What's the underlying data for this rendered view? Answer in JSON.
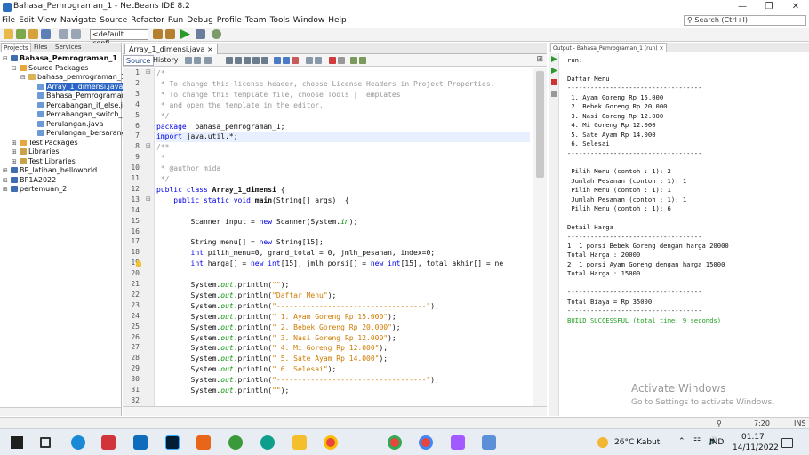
{
  "window": {
    "title": "Bahasa_Pemrograman_1 - NetBeans IDE 8.2"
  },
  "menu": [
    "File",
    "Edit",
    "View",
    "Navigate",
    "Source",
    "Refactor",
    "Run",
    "Debug",
    "Profile",
    "Team",
    "Tools",
    "Window",
    "Help"
  ],
  "search": {
    "placeholder": "Search (Ctrl+I)"
  },
  "toolbar": {
    "config": "<default confi..."
  },
  "projects": {
    "tabs": [
      "Projects",
      "Files",
      "Services"
    ],
    "tree": [
      {
        "label": "Bahasa_Pemrograman_1",
        "level": 0,
        "bold": true,
        "toggle": "−",
        "icon": "#3d6fb0"
      },
      {
        "label": "Source Packages",
        "level": 1,
        "toggle": "−",
        "icon": "#e7a73a"
      },
      {
        "label": "bahasa_pemrograman_1",
        "level": 2,
        "toggle": "−",
        "icon": "#d9b25a"
      },
      {
        "label": "Array_1_dimensi.java",
        "level": 3,
        "selected": true,
        "icon": "#6b9ad6"
      },
      {
        "label": "Bahasa_Pemrograman_1.java",
        "level": 3,
        "icon": "#6b9ad6"
      },
      {
        "label": "Percabangan_if_else.java",
        "level": 3,
        "icon": "#6b9ad6"
      },
      {
        "label": "Percabangan_switch_case.java",
        "level": 3,
        "icon": "#6b9ad6"
      },
      {
        "label": "Perulangan.java",
        "level": 3,
        "icon": "#6b9ad6"
      },
      {
        "label": "Perulangan_bersarang.java",
        "level": 3,
        "icon": "#6b9ad6"
      },
      {
        "label": "Test Packages",
        "level": 1,
        "toggle": "+",
        "icon": "#e7a73a"
      },
      {
        "label": "Libraries",
        "level": 1,
        "toggle": "+",
        "icon": "#c9a24a"
      },
      {
        "label": "Test Libraries",
        "level": 1,
        "toggle": "+",
        "icon": "#c9a24a"
      },
      {
        "label": "BP_latihan_helloworld",
        "level": 0,
        "toggle": "+",
        "icon": "#3d6fb0"
      },
      {
        "label": "BP1A2022",
        "level": 0,
        "toggle": "+",
        "icon": "#3d6fb0"
      },
      {
        "label": "pertemuan_2",
        "level": 0,
        "toggle": "+",
        "icon": "#3d6fb0"
      }
    ]
  },
  "editor": {
    "tab": "Array_1_dimensi.java",
    "views": [
      "Source",
      "History"
    ],
    "lines": [
      {
        "n": "1",
        "fold": "−",
        "parts": [
          [
            "cm",
            "/*"
          ]
        ]
      },
      {
        "n": "2",
        "parts": [
          [
            "cm",
            " * To change this license header, choose License Headers in Project Properties."
          ]
        ]
      },
      {
        "n": "3",
        "parts": [
          [
            "cm",
            " * To change this template file, choose Tools | Templates"
          ]
        ]
      },
      {
        "n": "4",
        "parts": [
          [
            "cm",
            " * and open the template in the editor."
          ]
        ]
      },
      {
        "n": "5",
        "parts": [
          [
            "cm",
            " */"
          ]
        ]
      },
      {
        "n": "6",
        "parts": [
          [
            "kw",
            "package"
          ],
          [
            "",
            "  bahasa_pemrograman_1;"
          ]
        ]
      },
      {
        "n": "7",
        "hl": true,
        "parts": [
          [
            "kw",
            "import"
          ],
          [
            "",
            " java.util.*;"
          ]
        ]
      },
      {
        "n": "8",
        "fold": "−",
        "parts": [
          [
            "cm",
            "/**"
          ]
        ]
      },
      {
        "n": "9",
        "parts": [
          [
            "cm",
            " *"
          ]
        ]
      },
      {
        "n": "10",
        "parts": [
          [
            "cm",
            " * @author mida"
          ]
        ]
      },
      {
        "n": "11",
        "parts": [
          [
            "cm",
            " */"
          ]
        ]
      },
      {
        "n": "12",
        "parts": [
          [
            "kw",
            "public class "
          ],
          [
            "bo",
            "Array_1_dimensi"
          ],
          [
            "",
            " {"
          ]
        ]
      },
      {
        "n": "13",
        "fold": "−",
        "parts": [
          [
            "",
            "    "
          ],
          [
            "kw",
            "public static void "
          ],
          [
            "bo",
            "main"
          ],
          [
            "",
            "(String[] args)  {"
          ]
        ]
      },
      {
        "n": "14",
        "parts": [
          [
            "",
            ""
          ]
        ]
      },
      {
        "n": "15",
        "parts": [
          [
            "",
            "        Scanner input = "
          ],
          [
            "kw",
            "new"
          ],
          [
            "",
            " Scanner(System."
          ],
          [
            "fd",
            "in"
          ],
          [
            "",
            ");"
          ]
        ]
      },
      {
        "n": "16",
        "parts": [
          [
            "",
            ""
          ]
        ]
      },
      {
        "n": "17",
        "parts": [
          [
            "",
            "        String menu[] = "
          ],
          [
            "kw",
            "new"
          ],
          [
            "",
            " String[15];"
          ]
        ]
      },
      {
        "n": "18",
        "parts": [
          [
            "",
            "        "
          ],
          [
            "kw",
            "int"
          ],
          [
            "",
            " pilih_menu=0, grand_total = 0, jmlh_pesanan, index=0;"
          ]
        ]
      },
      {
        "n": "19",
        "parts": [
          [
            "",
            "        "
          ],
          [
            "kw",
            "int"
          ],
          [
            "",
            " harga[] = "
          ],
          [
            "kw",
            "new int"
          ],
          [
            "",
            "[15], jmlh_porsi[] = "
          ],
          [
            "kw",
            "new int"
          ],
          [
            "",
            "[15], total_akhir[] = ne"
          ]
        ]
      },
      {
        "n": "20",
        "parts": [
          [
            "",
            ""
          ]
        ]
      },
      {
        "n": "21",
        "parts": [
          [
            "",
            "        System."
          ],
          [
            "fd",
            "out"
          ],
          [
            "",
            ".println("
          ],
          [
            "st",
            "\"\""
          ],
          [
            "",
            ");"
          ]
        ]
      },
      {
        "n": "22",
        "parts": [
          [
            "",
            "        System."
          ],
          [
            "fd",
            "out"
          ],
          [
            "",
            ".println("
          ],
          [
            "st",
            "\"Daftar Menu\""
          ],
          [
            "",
            ");"
          ]
        ]
      },
      {
        "n": "23",
        "parts": [
          [
            "",
            "        System."
          ],
          [
            "fd",
            "out"
          ],
          [
            "",
            ".println("
          ],
          [
            "st",
            "\"-----------------------------------\""
          ],
          [
            "",
            ");"
          ]
        ]
      },
      {
        "n": "24",
        "parts": [
          [
            "",
            "        System."
          ],
          [
            "fd",
            "out"
          ],
          [
            "",
            ".println("
          ],
          [
            "st",
            "\" 1. Ayam Goreng Rp 15.000\""
          ],
          [
            "",
            ");"
          ]
        ]
      },
      {
        "n": "25",
        "parts": [
          [
            "",
            "        System."
          ],
          [
            "fd",
            "out"
          ],
          [
            "",
            ".println("
          ],
          [
            "st",
            "\" 2. Bebek Goreng Rp 20.000\""
          ],
          [
            "",
            ");"
          ]
        ]
      },
      {
        "n": "26",
        "parts": [
          [
            "",
            "        System."
          ],
          [
            "fd",
            "out"
          ],
          [
            "",
            ".println("
          ],
          [
            "st",
            "\" 3. Nasi Goreng Rp 12.000\""
          ],
          [
            "",
            ");"
          ]
        ]
      },
      {
        "n": "27",
        "parts": [
          [
            "",
            "        System."
          ],
          [
            "fd",
            "out"
          ],
          [
            "",
            ".println("
          ],
          [
            "st",
            "\" 4. Mi Goreng Rp 12.000\""
          ],
          [
            "",
            ");"
          ]
        ]
      },
      {
        "n": "28",
        "parts": [
          [
            "",
            "        System."
          ],
          [
            "fd",
            "out"
          ],
          [
            "",
            ".println("
          ],
          [
            "st",
            "\" 5. Sate Ayam Rp 14.000\""
          ],
          [
            "",
            ");"
          ]
        ]
      },
      {
        "n": "29",
        "parts": [
          [
            "",
            "        System."
          ],
          [
            "fd",
            "out"
          ],
          [
            "",
            ".println("
          ],
          [
            "st",
            "\" 6. Selesai\""
          ],
          [
            "",
            ");"
          ]
        ]
      },
      {
        "n": "30",
        "parts": [
          [
            "",
            "        System."
          ],
          [
            "fd",
            "out"
          ],
          [
            "",
            ".println("
          ],
          [
            "st",
            "\"-----------------------------------\""
          ],
          [
            "",
            ");"
          ]
        ]
      },
      {
        "n": "31",
        "parts": [
          [
            "",
            "        System."
          ],
          [
            "fd",
            "out"
          ],
          [
            "",
            ".println("
          ],
          [
            "st",
            "\"\""
          ],
          [
            "",
            ");"
          ]
        ]
      },
      {
        "n": "32",
        "parts": [
          [
            "",
            ""
          ]
        ]
      }
    ]
  },
  "output": {
    "tab": "Output - Bahasa_Pemrograman_1 (run)",
    "lines": [
      {
        "t": "run:"
      },
      {
        "t": ""
      },
      {
        "t": "Daftar Menu"
      },
      {
        "t": "-----------------------------------"
      },
      {
        "t": " 1. Ayam Goreng Rp 15.000"
      },
      {
        "t": " 2. Bebek Goreng Rp 20.000"
      },
      {
        "t": " 3. Nasi Goreng Rp 12.000"
      },
      {
        "t": " 4. Mi Goreng Rp 12.000"
      },
      {
        "t": " 5. Sate Ayam Rp 14.000"
      },
      {
        "t": " 6. Selesai"
      },
      {
        "t": "-----------------------------------"
      },
      {
        "t": ""
      },
      {
        "t": " Pilih Menu (contoh : 1): 2"
      },
      {
        "t": " Jumlah Pesanan (contoh : 1): 1"
      },
      {
        "t": " Pilih Menu (contoh : 1): 1"
      },
      {
        "t": " Jumlah Pesanan (contoh : 1): 1"
      },
      {
        "t": " Pilih Menu (contoh : 1): 6"
      },
      {
        "t": ""
      },
      {
        "t": "Detail Harga"
      },
      {
        "t": "-----------------------------------"
      },
      {
        "t": "1. 1 porsi Bebek Goreng dengan harga 20000"
      },
      {
        "t": "Total Harga : 20000"
      },
      {
        "t": "2. 1 porsi Ayam Goreng dengan harga 15000"
      },
      {
        "t": "Total Harga : 15000"
      },
      {
        "t": ""
      },
      {
        "t": "-----------------------------------"
      },
      {
        "t": "Total Biaya = Rp 35000"
      },
      {
        "t": "-----------------------------------"
      },
      {
        "t": "BUILD SUCCESSFUL (total time: 9 seconds)",
        "ok": true
      }
    ],
    "watermark1": "Activate Windows",
    "watermark2": "Go to Settings to activate Windows."
  },
  "status": {
    "position": "7:20",
    "mode": "INS"
  },
  "taskbar": {
    "weather": "26°C  Kabut",
    "lang": "IND",
    "time": "01.17",
    "date": "14/11/2022"
  }
}
